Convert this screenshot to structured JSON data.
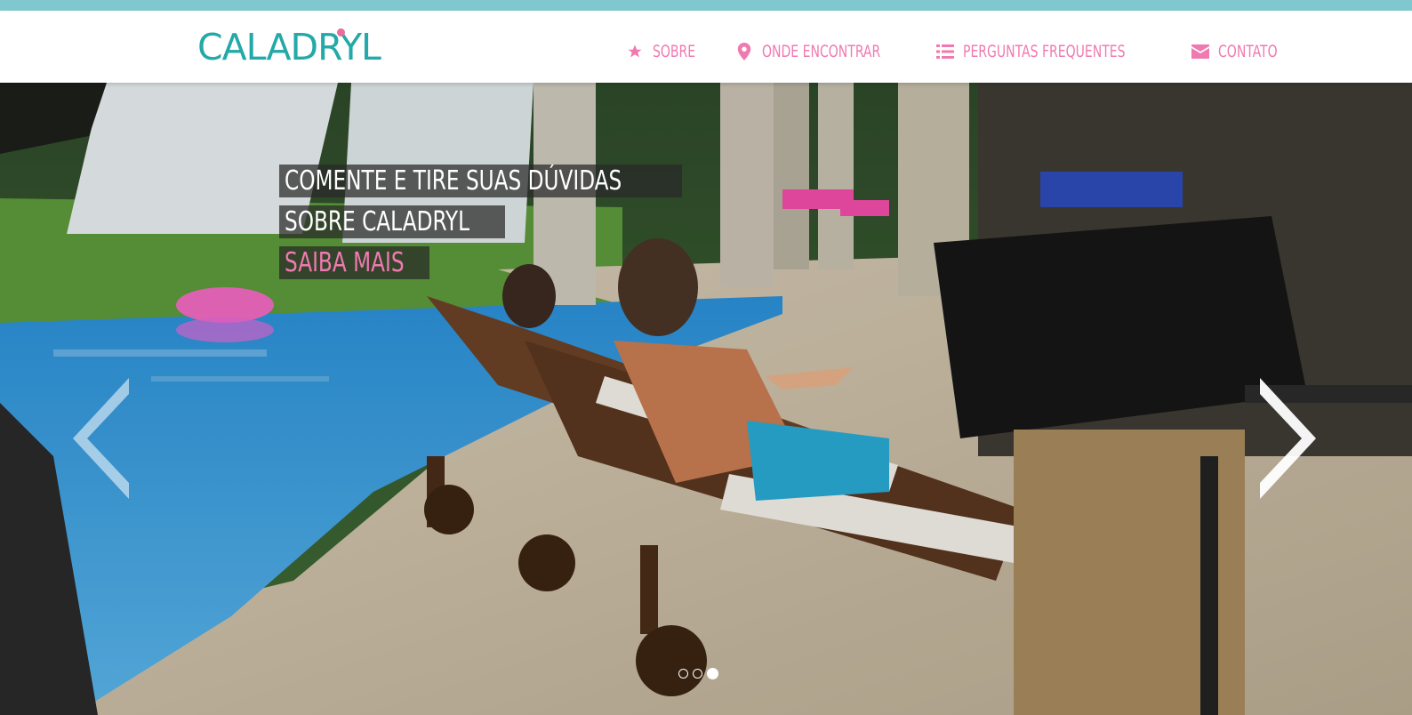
{
  "brand": {
    "name": "CALADRYL",
    "logo_color": "#23a9a7",
    "accent_color": "#ec6a9c"
  },
  "nav": {
    "items": [
      {
        "label": "SOBRE",
        "icon": "star-icon"
      },
      {
        "label": "ONDE ENCONTRAR",
        "icon": "map-marker-icon"
      },
      {
        "label": "PERGUNTAS FREQUENTES",
        "icon": "list-icon"
      },
      {
        "label": "CONTATO",
        "icon": "envelope-icon"
      }
    ],
    "color": "#f07ab0"
  },
  "carousel": {
    "caption": {
      "line1": "COMENTE E TIRE SUAS DÚVIDAS",
      "line2": "SOBRE CALADRYL",
      "link": "SAIBA MAIS"
    },
    "prev_icon": "chevron-left-icon",
    "next_icon": "chevron-right-icon",
    "slide_count": 3,
    "active_slide": 3
  },
  "colors": {
    "top_strip": "#7fc8d0"
  }
}
